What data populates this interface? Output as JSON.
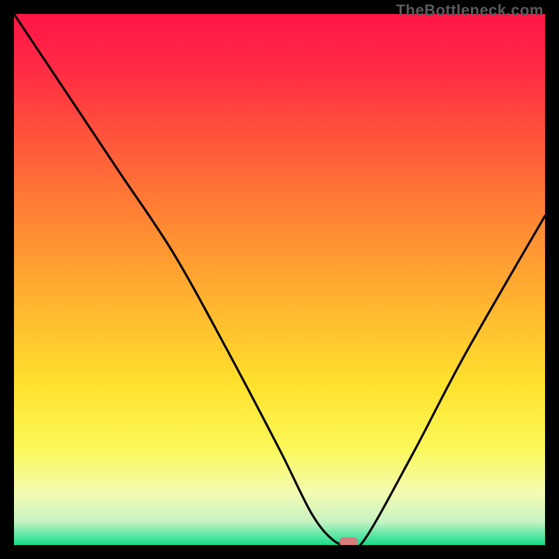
{
  "watermark": "TheBottleneck.com",
  "chart_data": {
    "type": "line",
    "title": "",
    "xlabel": "",
    "ylabel": "",
    "xlim": [
      0,
      100
    ],
    "ylim": [
      0,
      100
    ],
    "series": [
      {
        "name": "bottleneck-curve",
        "x": [
          0,
          12,
          20,
          30,
          40,
          50,
          56,
          60,
          63,
          66,
          75,
          85,
          100
        ],
        "values": [
          100,
          82,
          70,
          55,
          37,
          18,
          6,
          1,
          0,
          1,
          17,
          36,
          62
        ]
      }
    ],
    "marker": {
      "x": 63,
      "y": 0.6,
      "color": "#d77a7a"
    },
    "gradient_stops": [
      {
        "offset": 0.0,
        "color": "#ff1547"
      },
      {
        "offset": 0.1,
        "color": "#ff2a44"
      },
      {
        "offset": 0.25,
        "color": "#ff5a3a"
      },
      {
        "offset": 0.4,
        "color": "#ff8a33"
      },
      {
        "offset": 0.55,
        "color": "#ffb62f"
      },
      {
        "offset": 0.7,
        "color": "#ffe22e"
      },
      {
        "offset": 0.82,
        "color": "#fbf85a"
      },
      {
        "offset": 0.9,
        "color": "#f4fbb0"
      },
      {
        "offset": 0.955,
        "color": "#c9f3c3"
      },
      {
        "offset": 0.985,
        "color": "#4fe6a2"
      },
      {
        "offset": 1.0,
        "color": "#17d987"
      }
    ]
  }
}
